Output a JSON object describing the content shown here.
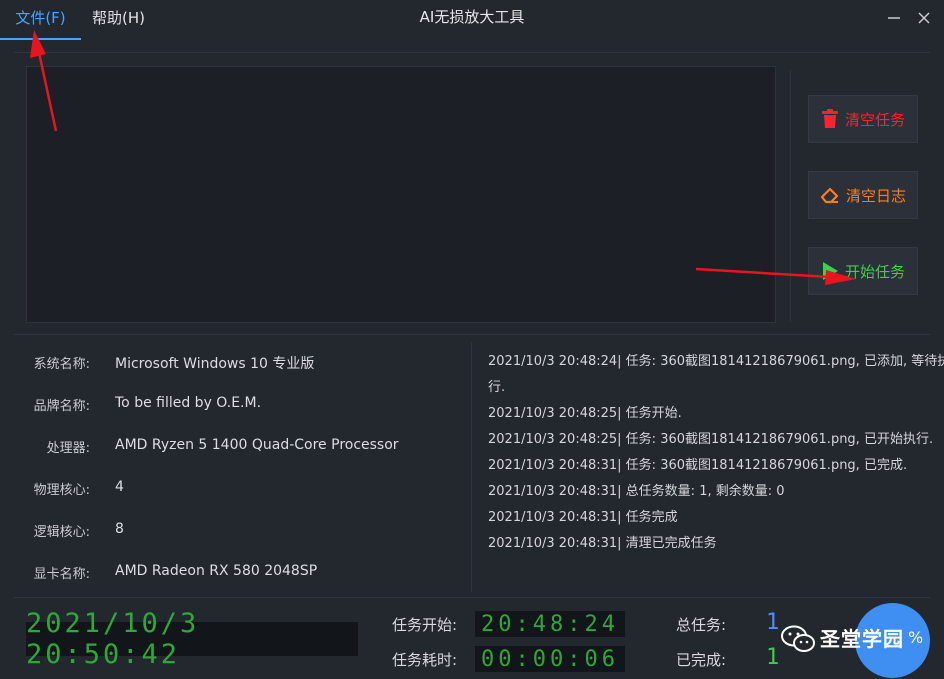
{
  "titlebar": {
    "title": "AI无损放大工具",
    "menus": [
      {
        "label": "文件(F)"
      },
      {
        "label": "帮助(H)"
      }
    ]
  },
  "actions": {
    "clear_tasks": "清空任务",
    "clear_log": "清空日志",
    "start_task": "开始任务"
  },
  "system_info": [
    {
      "label": "系统名称:",
      "value": "Microsoft Windows 10 专业版"
    },
    {
      "label": "品牌名称:",
      "value": "To be filled by O.E.M."
    },
    {
      "label": "处理器:",
      "value": "AMD Ryzen 5 1400 Quad-Core Processor"
    },
    {
      "label": "物理核心:",
      "value": "4"
    },
    {
      "label": "逻辑核心:",
      "value": "8"
    },
    {
      "label": "显卡名称:",
      "value": "AMD Radeon RX 580 2048SP"
    }
  ],
  "log": [
    "2021/10/3 20:48:24| 任务: 360截图18141218679061.png, 已添加, 等待执",
    "行.",
    "2021/10/3 20:48:25| 任务开始.",
    "2021/10/3 20:48:25| 任务: 360截图18141218679061.png, 已开始执行.",
    "2021/10/3 20:48:31| 任务: 360截图18141218679061.png, 已完成.",
    "2021/10/3 20:48:31| 总任务数量: 1, 剩余数量: 0",
    "2021/10/3 20:48:31| 任务完成",
    "2021/10/3 20:48:31| 清理已完成任务"
  ],
  "status": {
    "clock": "2021/10/3 20:50:42",
    "task_start_label": "任务开始:",
    "task_start_value": "20:48:24",
    "task_elapsed_label": "任务耗时:",
    "task_elapsed_value": "00:00:06",
    "total_label": "总任务:",
    "total_value": "1",
    "done_label": "已完成:",
    "done_value": "1"
  },
  "watermark": {
    "text": "圣堂学园",
    "suffix": "%"
  },
  "colors": {
    "accent": "#4aa3ff",
    "clear_tasks": "#ff2030",
    "clear_log": "#ff7e1a",
    "start": "#3fcf4a",
    "led": "#2fa83a"
  }
}
